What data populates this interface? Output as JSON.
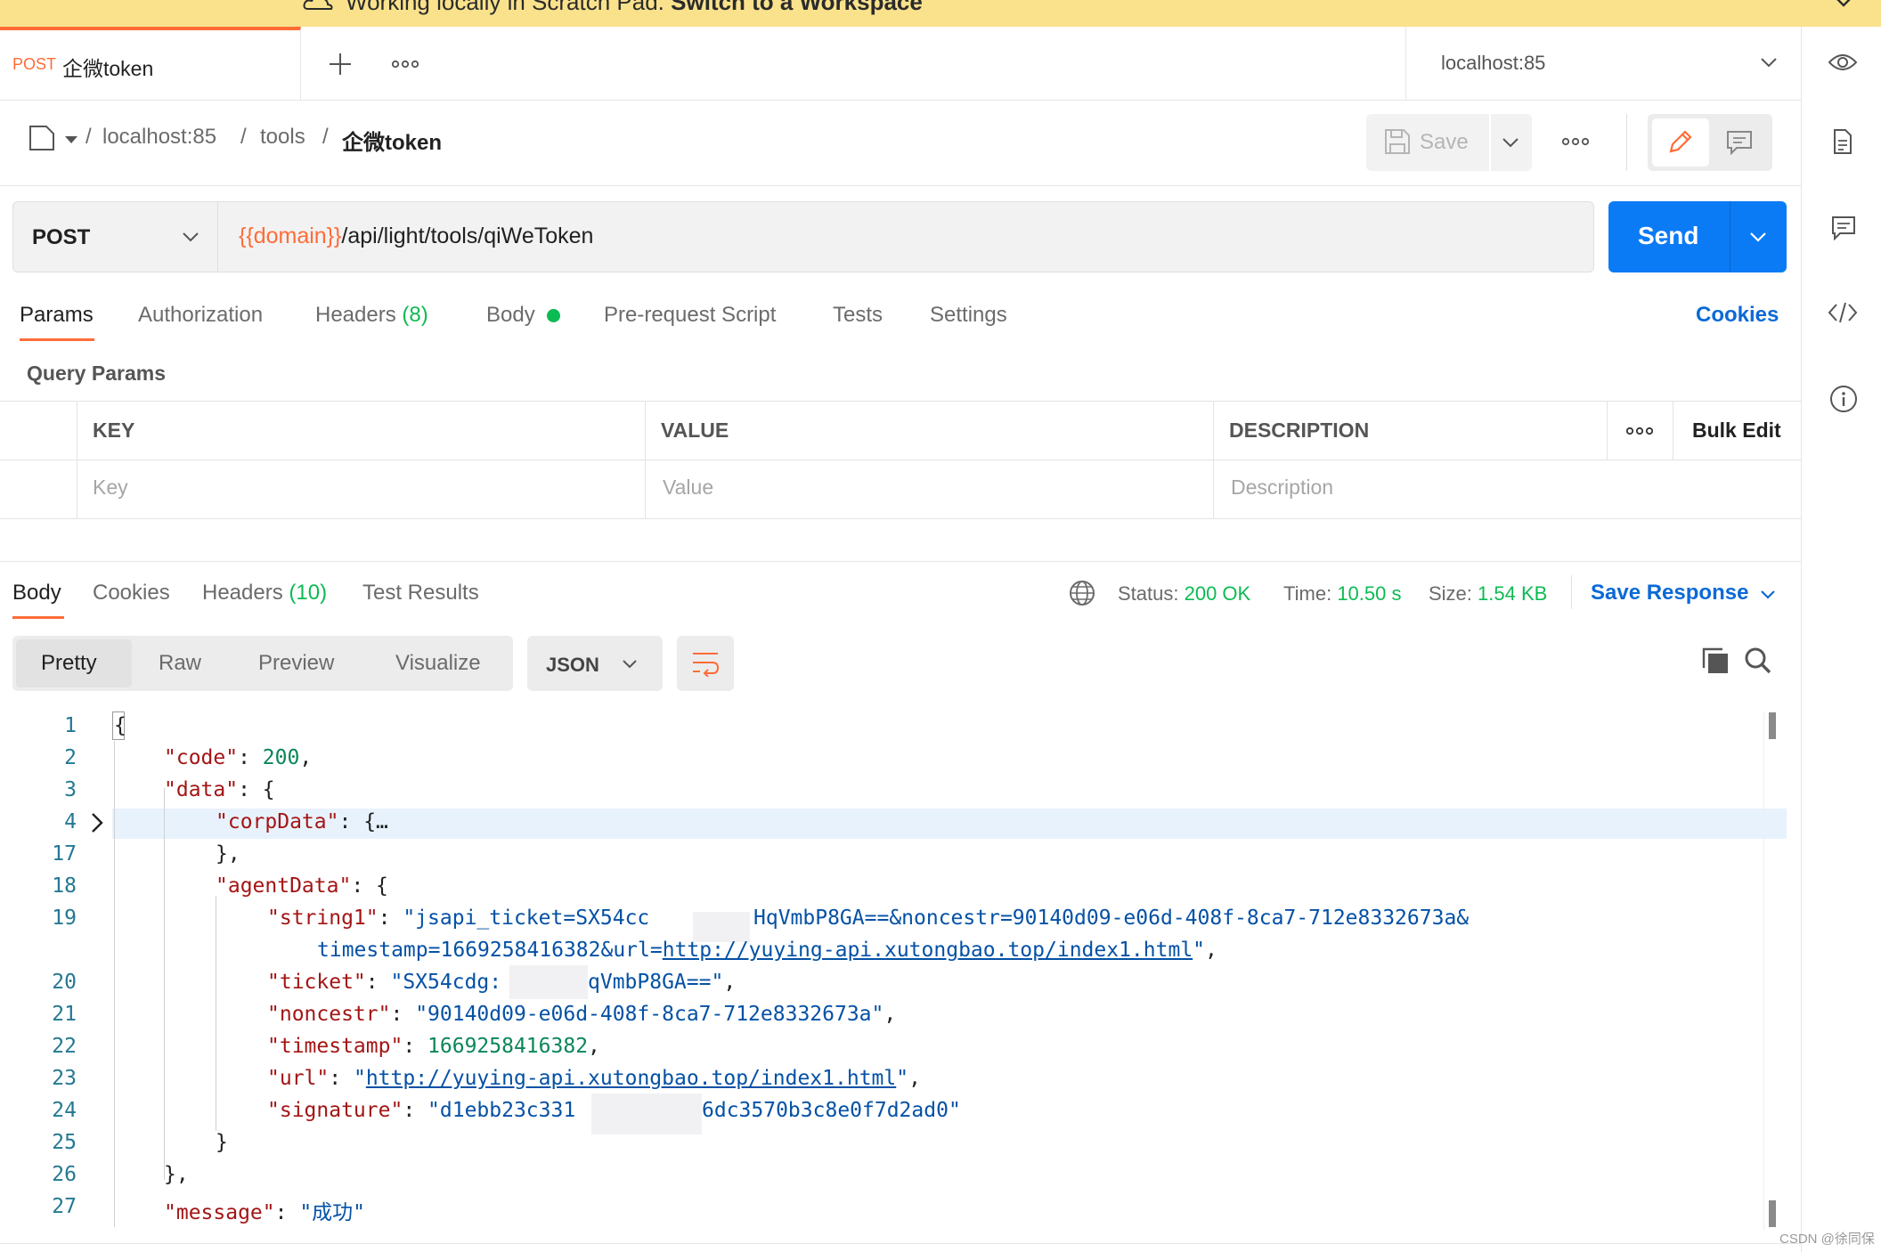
{
  "banner": {
    "prefix": "Working locally in Scratch Pad. ",
    "link": "Switch to a Workspace"
  },
  "tab": {
    "method": "POST",
    "title": "企微token"
  },
  "environment": {
    "selected": "localhost:85"
  },
  "breadcrumb": {
    "items": [
      "localhost:85",
      "tools"
    ],
    "current": "企微token"
  },
  "toolbar": {
    "save_label": "Save"
  },
  "request": {
    "method": "POST",
    "url_variable": "{{domain}}",
    "url_path": "/api/light/tools/qiWeToken",
    "send_label": "Send"
  },
  "request_tabs": {
    "params": "Params",
    "authorization": "Authorization",
    "headers": "Headers",
    "headers_count": "(8)",
    "body": "Body",
    "prerequest": "Pre-request Script",
    "tests": "Tests",
    "settings": "Settings",
    "cookies": "Cookies"
  },
  "query_params": {
    "label": "Query Params",
    "columns": {
      "key": "KEY",
      "value": "VALUE",
      "description": "DESCRIPTION"
    },
    "bulk_edit": "Bulk Edit",
    "placeholder": {
      "key": "Key",
      "value": "Value",
      "description": "Description"
    }
  },
  "response_tabs": {
    "body": "Body",
    "cookies": "Cookies",
    "headers": "Headers",
    "headers_count": "(10)",
    "test_results": "Test Results"
  },
  "response_meta": {
    "status_label": "Status:",
    "status_value": "200 OK",
    "time_label": "Time:",
    "time_value": "10.50 s",
    "size_label": "Size:",
    "size_value": "1.54 KB",
    "save_response": "Save Response"
  },
  "view_modes": {
    "pretty": "Pretty",
    "raw": "Raw",
    "preview": "Preview",
    "visualize": "Visualize",
    "format": "JSON"
  },
  "code_lines": {
    "n1": "1",
    "n2": "2",
    "n3": "3",
    "n4": "4",
    "n17": "17",
    "n18": "18",
    "n19": "19",
    "n20": "20",
    "n21": "21",
    "n22": "22",
    "n23": "23",
    "n24": "24",
    "n25": "25",
    "n26": "26",
    "n27": "27",
    "code_key": "\"code\"",
    "code_val": "200",
    "data_key": "\"data\"",
    "corp_key": "\"corpData\"",
    "corp_fold": "{…",
    "agent_key": "\"agentData\"",
    "string1_key": "\"string1\"",
    "string1_a": "\"jsapi_ticket=SX54cc",
    "string1_b": "HqVmbP8GA==&noncestr=90140d09-e06d-408f-8ca7-712e8332673a&",
    "string1_c": "timestamp=1669258416382&url=",
    "string1_url": "http://yuying-api.xutongbao.top/index1.html",
    "string1_end": "\"",
    "ticket_key": "\"ticket\"",
    "ticket_a": "\"SX54cdg:",
    "ticket_b": "qVmbP8GA==\"",
    "noncestr_key": "\"noncestr\"",
    "noncestr_val": "\"90140d09-e06d-408f-8ca7-712e8332673a\"",
    "timestamp_key": "\"timestamp\"",
    "timestamp_val": "1669258416382",
    "url_key": "\"url\"",
    "url_val": "http://yuying-api.xutongbao.top/index1.html",
    "signature_key": "\"signature\"",
    "signature_a": "\"d1ebb23c331",
    "signature_b": "6dc3570b3c8e0f7d2ad0\"",
    "message_key": "\"message\"",
    "message_val": "\"成功\""
  },
  "watermark": "CSDN @徐同保",
  "colors": {
    "accent": "#ff6c37",
    "primary": "#0b7bf5",
    "success": "#0cbb52",
    "banner": "#fae28c"
  }
}
